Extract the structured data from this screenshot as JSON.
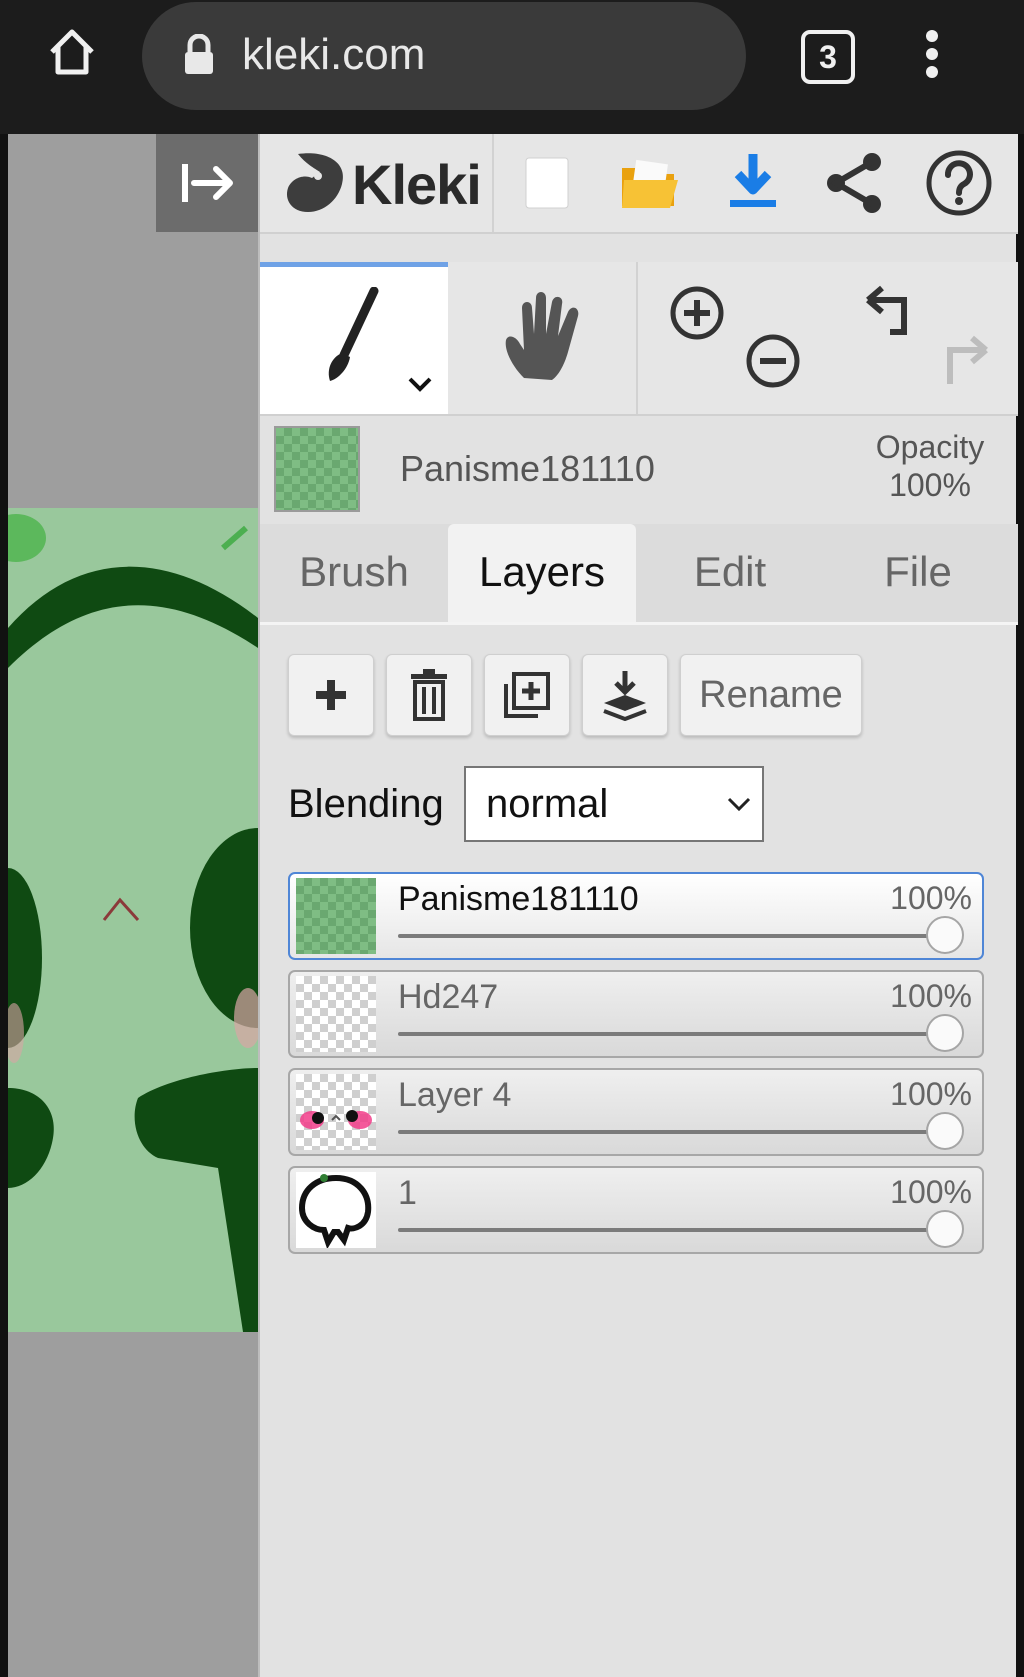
{
  "browser": {
    "url": "kleki.com",
    "tab_count": "3",
    "icons": [
      "home-icon",
      "lock-icon",
      "menu-dots-icon"
    ]
  },
  "app": {
    "logo_text": "Kleki",
    "toolbar_icons": [
      "new-image-icon",
      "open-folder-icon",
      "download-icon",
      "share-icon",
      "help-icon"
    ],
    "tools": [
      "brush-icon",
      "hand-icon",
      "zoom-in-icon",
      "zoom-out-icon",
      "undo-icon",
      "redo-icon"
    ]
  },
  "current_layer": {
    "name": "Panisme181110",
    "opacity_label": "Opacity",
    "opacity_value": "100%"
  },
  "tabs": [
    {
      "label": "Brush",
      "active": false
    },
    {
      "label": "Layers",
      "active": true
    },
    {
      "label": "Edit",
      "active": false
    },
    {
      "label": "File",
      "active": false
    }
  ],
  "layer_actions": {
    "icons": [
      "add-layer-icon",
      "delete-layer-icon",
      "duplicate-layer-icon",
      "merge-down-icon"
    ],
    "rename_label": "Rename"
  },
  "blending": {
    "label": "Blending",
    "value": "normal"
  },
  "layers": [
    {
      "name": "Panisme181110",
      "opacity": "100%",
      "opacity_fraction": 1.0,
      "selected": true
    },
    {
      "name": "Hd247",
      "opacity": "100%",
      "opacity_fraction": 1.0,
      "selected": false
    },
    {
      "name": "Layer 4",
      "opacity": "100%",
      "opacity_fraction": 1.0,
      "selected": false
    },
    {
      "name": "1",
      "opacity": "100%",
      "opacity_fraction": 1.0,
      "selected": false
    }
  ],
  "colors": {
    "accent_blue": "#4f86d6",
    "download_blue": "#1a7de6",
    "canvas_green": "#99c89c",
    "drawing_dark_green": "#0f4a12"
  }
}
